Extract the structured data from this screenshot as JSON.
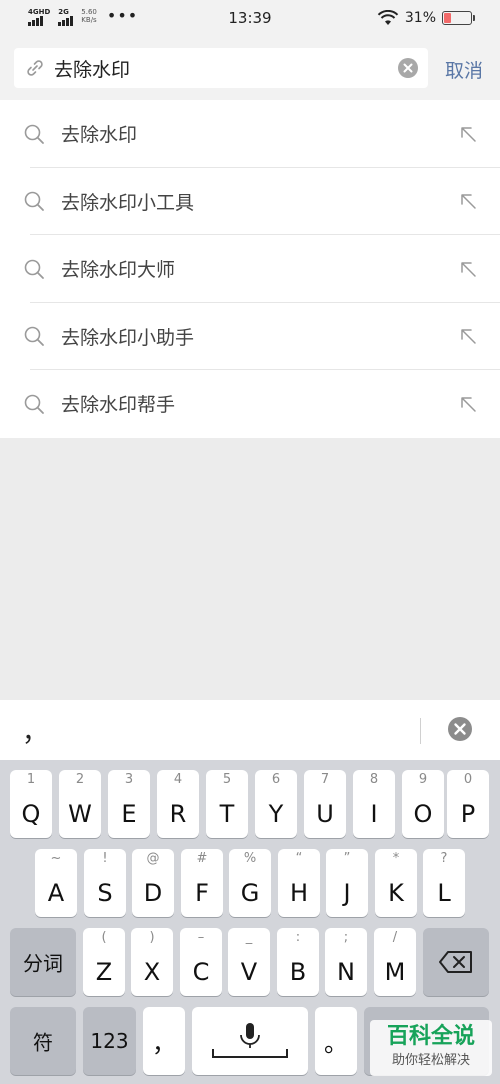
{
  "status_bar": {
    "network1": "4GHD",
    "network2": "2G",
    "speed_value": "5.60",
    "speed_unit": "KB/s",
    "dots": "•••",
    "time": "13:39",
    "battery_percent": "31%",
    "battery_level": 0.31,
    "battery_color": "#f26a6a"
  },
  "search": {
    "value": "去除水印",
    "cancel_label": "取消",
    "accent_color": "#5a77a6"
  },
  "suggestions": [
    {
      "label": "去除水印"
    },
    {
      "label": "去除水印小工具"
    },
    {
      "label": "去除水印大师"
    },
    {
      "label": "去除水印小助手"
    },
    {
      "label": "去除水印帮手"
    }
  ],
  "candidate_bar": {
    "candidate": "，"
  },
  "keyboard": {
    "row1": [
      {
        "hint": "1",
        "key": "Q"
      },
      {
        "hint": "2",
        "key": "W"
      },
      {
        "hint": "3",
        "key": "E"
      },
      {
        "hint": "4",
        "key": "R"
      },
      {
        "hint": "5",
        "key": "T"
      },
      {
        "hint": "6",
        "key": "Y"
      },
      {
        "hint": "7",
        "key": "U"
      },
      {
        "hint": "8",
        "key": "I"
      },
      {
        "hint": "9",
        "key": "O"
      },
      {
        "hint": "0",
        "key": "P"
      }
    ],
    "row2": [
      {
        "hint": "~",
        "key": "A"
      },
      {
        "hint": "!",
        "key": "S"
      },
      {
        "hint": "@",
        "key": "D"
      },
      {
        "hint": "#",
        "key": "F"
      },
      {
        "hint": "%",
        "key": "G"
      },
      {
        "hint": "“",
        "key": "H"
      },
      {
        "hint": "”",
        "key": "J"
      },
      {
        "hint": "*",
        "key": "K"
      },
      {
        "hint": "?",
        "key": "L"
      }
    ],
    "row3": [
      {
        "hint": "(",
        "key": "Z"
      },
      {
        "hint": ")",
        "key": "X"
      },
      {
        "hint": "–",
        "key": "C"
      },
      {
        "hint": "_",
        "key": "V"
      },
      {
        "hint": ":",
        "key": "B"
      },
      {
        "hint": ";",
        "key": "N"
      },
      {
        "hint": "/",
        "key": "M"
      }
    ],
    "segment_label": "分词",
    "symbol_label": "符",
    "numbers_label": "123",
    "comma_label": "，",
    "period_label": "。"
  },
  "watermark": {
    "title": "百科全说",
    "subtitle": "助你轻松解决"
  }
}
